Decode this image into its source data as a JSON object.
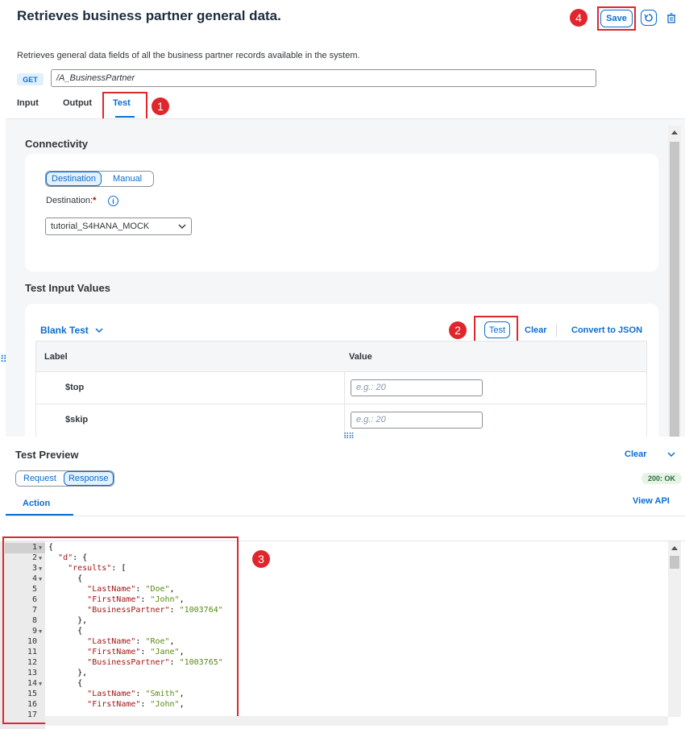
{
  "header": {
    "title": "Retrieves business partner general data.",
    "save_label": "Save"
  },
  "description": "Retrieves general data fields of all the business partner records available in the system.",
  "endpoint": {
    "method": "GET",
    "path": "/A_BusinessPartner"
  },
  "tabs": [
    {
      "label": "Input"
    },
    {
      "label": "Output"
    },
    {
      "label": "Test"
    }
  ],
  "markers": [
    "1",
    "2",
    "3",
    "4"
  ],
  "connectivity": {
    "title": "Connectivity",
    "modes": [
      "Destination",
      "Manual"
    ],
    "destination_label": "Destination:",
    "required_mark": "*",
    "destination_value": "tutorial_S4HANA_MOCK"
  },
  "test_input": {
    "title": "Test Input Values",
    "blank_test": "Blank Test",
    "test_button": "Test",
    "clear": "Clear",
    "convert": "Convert to JSON",
    "columns": [
      "Label",
      "Value"
    ],
    "rows": [
      {
        "label": "$top",
        "placeholder": "e.g.: 20"
      },
      {
        "label": "$skip",
        "placeholder": "e.g.: 20"
      }
    ]
  },
  "preview": {
    "title": "Test Preview",
    "clear": "Clear",
    "modes": [
      "Request",
      "Response"
    ],
    "status": "200: OK",
    "action_tab": "Action",
    "view_api": "View API"
  },
  "code": {
    "line_numbers": [
      "1",
      "2",
      "3",
      "4",
      "5",
      "6",
      "7",
      "8",
      "9",
      "10",
      "11",
      "12",
      "13",
      "14",
      "15",
      "16",
      "17"
    ]
  },
  "colors": {
    "accent": "#0a6ed1",
    "marker": "#e0262d",
    "success": "#256f3a"
  }
}
